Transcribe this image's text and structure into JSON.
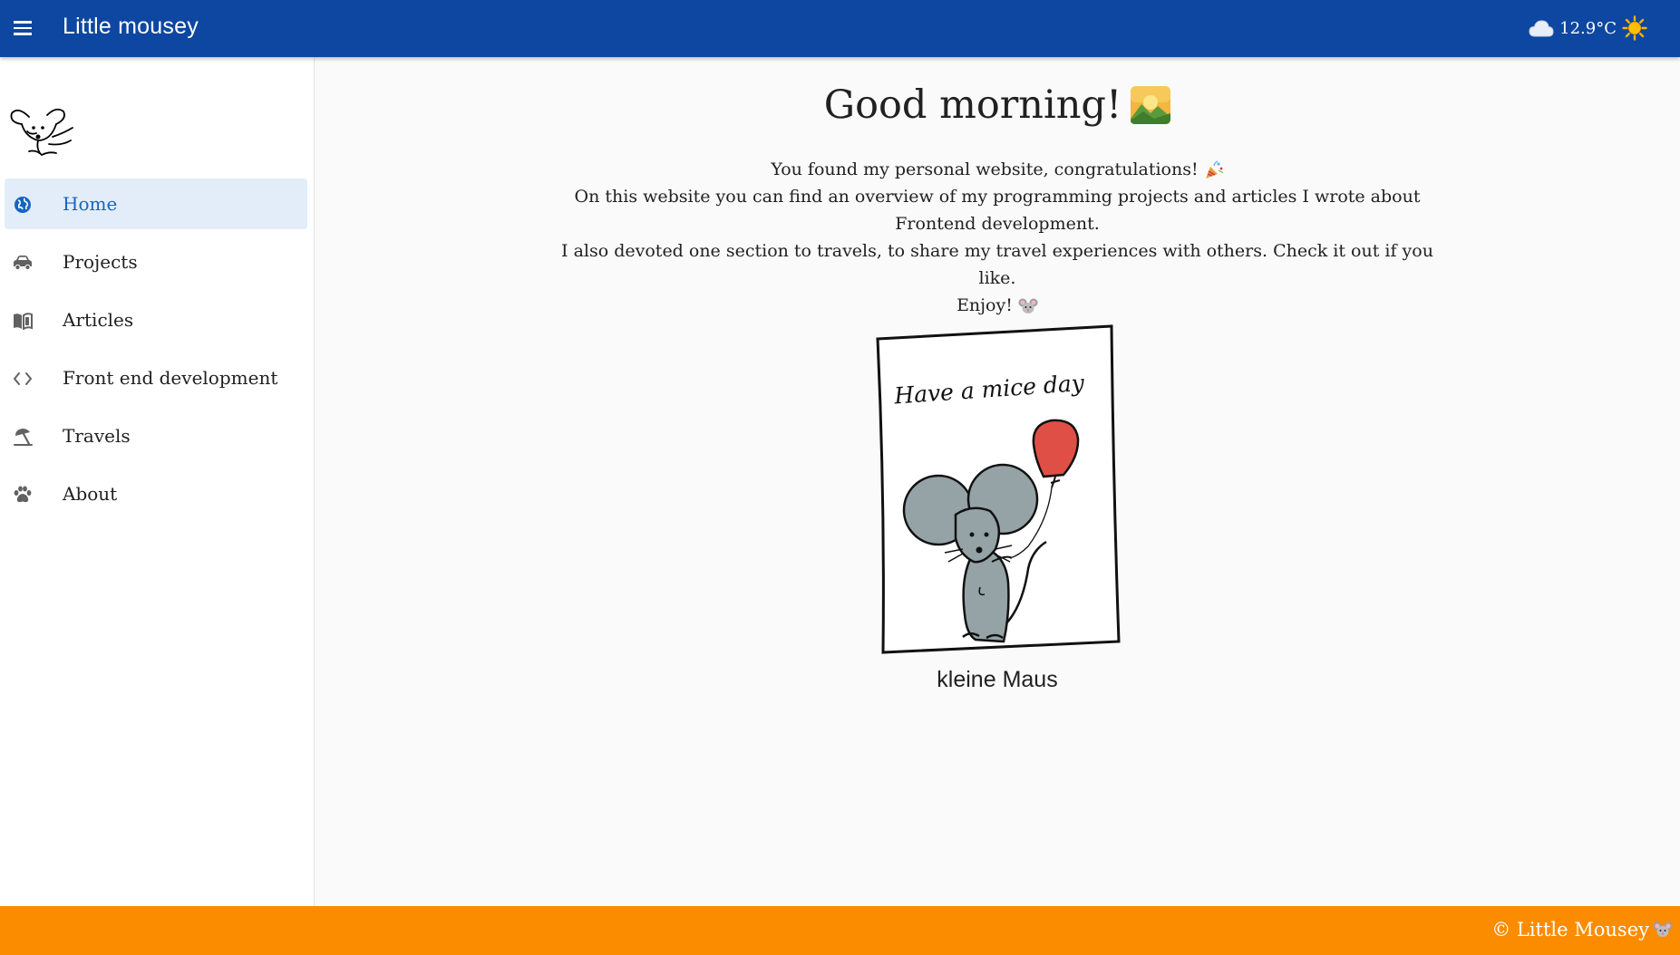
{
  "appbar": {
    "title": "Little mousey",
    "menu_icon": "hamburger-menu-icon",
    "weather": {
      "cloud_icon": "cloud-icon",
      "temperature": "12.9°C",
      "sun_icon": "sun-icon"
    },
    "color": "#0d47a1"
  },
  "sidebar": {
    "logo_icon": "mouse-logo-icon",
    "items": [
      {
        "label": "Home",
        "icon": "globe-icon",
        "active": true
      },
      {
        "label": "Projects",
        "icon": "car-icon",
        "active": false
      },
      {
        "label": "Articles",
        "icon": "book-icon",
        "active": false
      },
      {
        "label": "Front end development",
        "icon": "code-icon",
        "active": false
      },
      {
        "label": "Travels",
        "icon": "umbrella-beach-icon",
        "active": false
      },
      {
        "label": "About",
        "icon": "paw-icon",
        "active": false
      }
    ],
    "active_color": "#1565c0"
  },
  "main": {
    "greeting": "Good morning!",
    "intro": [
      "You found my personal website, congratulations!",
      "On this website you can find an overview of my programming projects and articles I wrote about Frontend development.",
      "I also devoted one section to travels, to share my travel experiences with others. Check it out if you like.",
      "Enjoy!"
    ],
    "image_text": "Have a mice day",
    "caption": "kleine Maus"
  },
  "footer": {
    "text": "© Little Mousey",
    "color": "#fb8c00"
  }
}
